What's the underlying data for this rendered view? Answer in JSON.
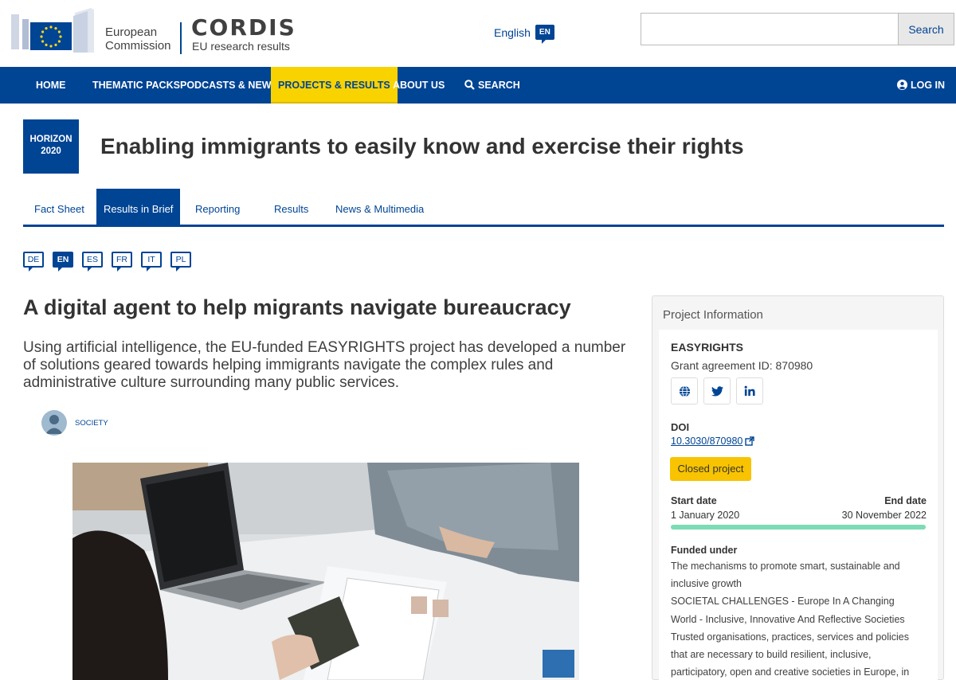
{
  "header": {
    "ec_logo_text_line1": "European",
    "ec_logo_text_line2": "Commission",
    "site_title": "CORDIS",
    "site_subtitle": "EU research results",
    "language_label": "English",
    "language_code": "EN",
    "search_placeholder": "",
    "search_button": "Search"
  },
  "nav": {
    "items": [
      {
        "label": "HOME"
      },
      {
        "label": "THEMATIC PACKS"
      },
      {
        "label": "PODCASTS & NEWS"
      },
      {
        "label": "PROJECTS & RESULTS",
        "active": true
      },
      {
        "label": "ABOUT US"
      },
      {
        "label": "SEARCH",
        "icon": "search-icon"
      }
    ],
    "login": "LOG IN"
  },
  "programme_badge": {
    "line1": "HORIZON",
    "line2": "2020"
  },
  "page_title": "Enabling immigrants to easily know and exercise their rights",
  "tabs": [
    {
      "label": "Fact Sheet"
    },
    {
      "label": "Results in Brief",
      "active": true
    },
    {
      "label": "Reporting"
    },
    {
      "label": "Results"
    },
    {
      "label": "News & Multimedia"
    }
  ],
  "languages": [
    "DE",
    "EN",
    "ES",
    "FR",
    "IT",
    "PL"
  ],
  "active_language": "EN",
  "article": {
    "title": "A digital agent to help migrants navigate bureaucracy",
    "summary": "Using artificial intelligence, the EU-funded EASYRIGHTS project has developed a number of solutions geared towards helping immigrants navigate the complex rules and administrative culture surrounding many public services.",
    "topic": "SOCIETY"
  },
  "project_info": {
    "heading": "Project Information",
    "acronym": "EASYRIGHTS",
    "grant": "Grant agreement ID: 870980",
    "social_icons": [
      "globe-icon",
      "twitter-icon",
      "linkedin-icon"
    ],
    "doi_label": "DOI",
    "doi_value": "10.3030/870980",
    "status": "Closed project",
    "start_label": "Start date",
    "end_label": "End date",
    "start_date": "1 January 2020",
    "end_date": "30 November 2022",
    "progress_fraction": 1.0,
    "funded_label": "Funded under",
    "funded_lines": [
      "The mechanisms to promote smart, sustainable and",
      "inclusive growth",
      "SOCIETAL CHALLENGES - Europe In A Changing",
      "World - Inclusive, Innovative And Reflective Societies",
      "Trusted organisations, practices, services and policies",
      "that are necessary to build resilient, inclusive,",
      "participatory, open and creative societies in Europe, in"
    ]
  },
  "colors": {
    "primary": "#004494",
    "accent": "#f8d300",
    "status": "#f8c300",
    "progress": "#7bdcb5"
  }
}
